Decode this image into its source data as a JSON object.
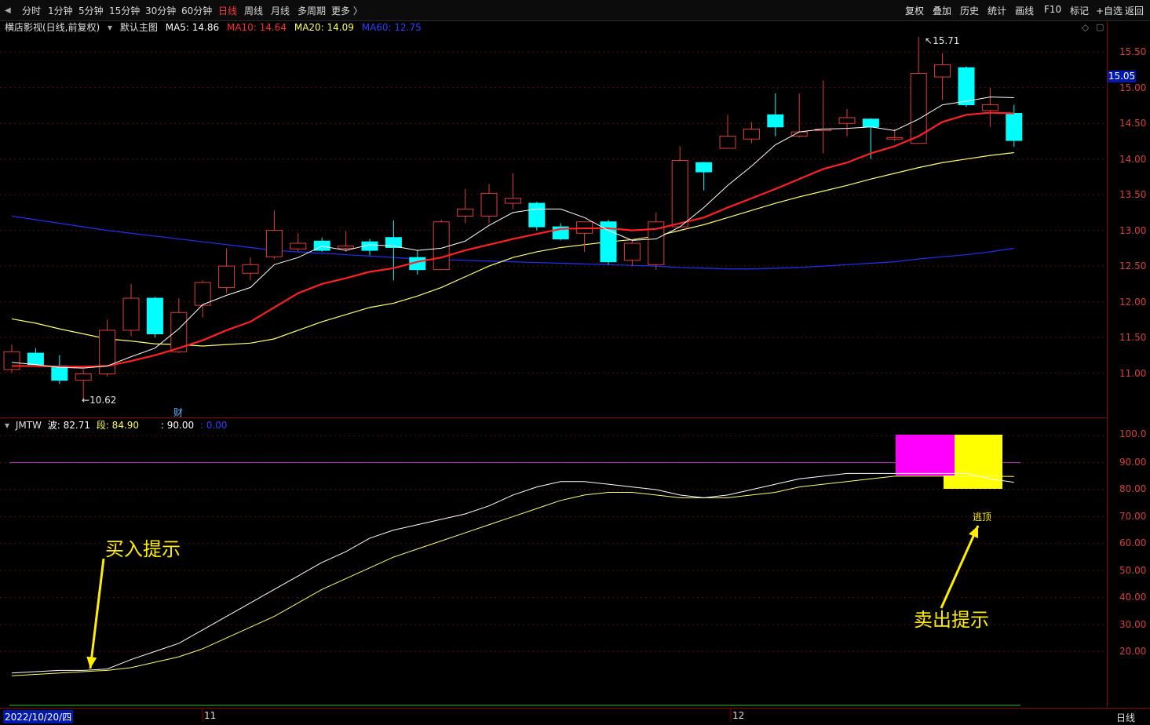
{
  "toolbar": {
    "timeframes": [
      "分时",
      "1分钟",
      "5分钟",
      "15分钟",
      "30分钟",
      "60分钟",
      "日线",
      "周线",
      "月线",
      "多周期",
      "更多 〉"
    ],
    "active_timeframe": "日线",
    "actions": [
      "复权",
      "叠加",
      "历史",
      "统计",
      "画线",
      "F10",
      "标记",
      "+自选",
      "返回"
    ]
  },
  "main_legend": {
    "stock": "横店影视(日线,前复权)",
    "template": "默认主图",
    "ma5": "MA5: 14.86",
    "ma10": "MA10: 14.64",
    "ma20": "MA20: 14.09",
    "ma60": "MA60: 12.75"
  },
  "sub_legend": {
    "name": "JMTW",
    "bo": "波: 82.71",
    "duan": "段: 84.90",
    "v3": ": 90.00",
    "v4": ": 0.00"
  },
  "price_axis": [
    "15.50",
    "15.00",
    "14.50",
    "14.00",
    "13.50",
    "13.00",
    "12.50",
    "12.00",
    "11.50",
    "11.00"
  ],
  "current_price": "15.05",
  "indicator_axis": [
    "100.0",
    "90.00",
    "80.00",
    "70.00",
    "60.00",
    "50.00",
    "40.00",
    "30.00",
    "20.00"
  ],
  "labels": {
    "high": "15.71",
    "low": "10.62",
    "finance_mark": "财",
    "escape_top": "逃顶",
    "buy_hint": "买入提示",
    "sell_hint": "卖出提示"
  },
  "date_axis": {
    "start": "2022/10/20/四",
    "month_nov": "11",
    "month_dec": "12",
    "period": "日线"
  },
  "colors": {
    "up": "#e03c3c",
    "down": "#00ffff",
    "ma5": "#ffffff",
    "ma10": "#ff2020",
    "ma20": "#ffff66",
    "ma60": "#2030ff",
    "annotation": "#ffee00"
  },
  "chart_data": {
    "type": "candlestick",
    "price_range": [
      10.5,
      15.8
    ],
    "candles": [
      {
        "o": 11.05,
        "h": 11.4,
        "l": 11.0,
        "c": 11.3
      },
      {
        "o": 11.28,
        "h": 11.35,
        "l": 11.1,
        "c": 11.12
      },
      {
        "o": 11.1,
        "h": 11.25,
        "l": 10.85,
        "c": 10.9
      },
      {
        "o": 10.9,
        "h": 11.05,
        "l": 10.62,
        "c": 10.99
      },
      {
        "o": 10.99,
        "h": 11.75,
        "l": 10.95,
        "c": 11.6
      },
      {
        "o": 11.6,
        "h": 12.25,
        "l": 11.52,
        "c": 12.05
      },
      {
        "o": 12.05,
        "h": 12.07,
        "l": 11.5,
        "c": 11.55
      },
      {
        "o": 11.3,
        "h": 12.05,
        "l": 11.28,
        "c": 11.85
      },
      {
        "o": 11.95,
        "h": 12.3,
        "l": 11.78,
        "c": 12.27
      },
      {
        "o": 12.2,
        "h": 12.75,
        "l": 12.12,
        "c": 12.5
      },
      {
        "o": 12.4,
        "h": 12.62,
        "l": 12.3,
        "c": 12.52
      },
      {
        "o": 12.63,
        "h": 13.28,
        "l": 12.6,
        "c": 13.0
      },
      {
        "o": 12.74,
        "h": 12.96,
        "l": 12.7,
        "c": 12.82
      },
      {
        "o": 12.85,
        "h": 12.9,
        "l": 12.7,
        "c": 12.72
      },
      {
        "o": 12.75,
        "h": 12.99,
        "l": 12.7,
        "c": 12.78
      },
      {
        "o": 12.84,
        "h": 12.88,
        "l": 12.65,
        "c": 12.72
      },
      {
        "o": 12.9,
        "h": 13.14,
        "l": 12.3,
        "c": 12.76
      },
      {
        "o": 12.62,
        "h": 12.72,
        "l": 12.38,
        "c": 12.45
      },
      {
        "o": 12.45,
        "h": 13.15,
        "l": 12.45,
        "c": 13.12
      },
      {
        "o": 13.2,
        "h": 13.58,
        "l": 13.1,
        "c": 13.3
      },
      {
        "o": 13.2,
        "h": 13.65,
        "l": 13.1,
        "c": 13.52
      },
      {
        "o": 13.38,
        "h": 13.8,
        "l": 13.3,
        "c": 13.45
      },
      {
        "o": 13.38,
        "h": 13.4,
        "l": 13.0,
        "c": 13.05
      },
      {
        "o": 13.05,
        "h": 13.1,
        "l": 12.86,
        "c": 12.88
      },
      {
        "o": 12.96,
        "h": 13.12,
        "l": 12.7,
        "c": 13.12
      },
      {
        "o": 13.12,
        "h": 13.15,
        "l": 12.52,
        "c": 12.56
      },
      {
        "o": 12.58,
        "h": 12.88,
        "l": 12.5,
        "c": 12.82
      },
      {
        "o": 12.52,
        "h": 13.25,
        "l": 12.45,
        "c": 13.12
      },
      {
        "o": 13.05,
        "h": 14.18,
        "l": 13.05,
        "c": 13.98
      },
      {
        "o": 13.95,
        "h": 13.96,
        "l": 13.56,
        "c": 13.82
      },
      {
        "o": 14.15,
        "h": 14.62,
        "l": 14.15,
        "c": 14.32
      },
      {
        "o": 14.28,
        "h": 14.52,
        "l": 14.22,
        "c": 14.42
      },
      {
        "o": 14.62,
        "h": 14.92,
        "l": 14.32,
        "c": 14.45
      },
      {
        "o": 14.32,
        "h": 14.92,
        "l": 14.3,
        "c": 14.38
      },
      {
        "o": 14.4,
        "h": 15.1,
        "l": 14.08,
        "c": 14.42
      },
      {
        "o": 14.5,
        "h": 14.7,
        "l": 14.32,
        "c": 14.58
      },
      {
        "o": 14.56,
        "h": 14.57,
        "l": 14.0,
        "c": 14.45
      },
      {
        "o": 14.28,
        "h": 14.42,
        "l": 14.25,
        "c": 14.3
      },
      {
        "o": 14.22,
        "h": 15.71,
        "l": 14.22,
        "c": 15.2
      },
      {
        "o": 15.15,
        "h": 15.48,
        "l": 14.83,
        "c": 15.32
      },
      {
        "o": 15.28,
        "h": 15.3,
        "l": 14.73,
        "c": 14.76
      },
      {
        "o": 14.68,
        "h": 15.0,
        "l": 14.45,
        "c": 14.76
      },
      {
        "o": 14.64,
        "h": 14.76,
        "l": 14.17,
        "c": 14.26
      }
    ],
    "ma5": [
      11.15,
      11.12,
      11.08,
      11.07,
      11.1,
      11.23,
      11.35,
      11.62,
      11.96,
      12.09,
      12.2,
      12.52,
      12.62,
      12.78,
      12.72,
      12.8,
      12.78,
      12.72,
      12.75,
      12.85,
      13.07,
      13.25,
      13.3,
      13.3,
      13.18,
      13.0,
      12.86,
      12.88,
      13.05,
      13.32,
      13.63,
      13.9,
      14.2,
      14.38,
      14.42,
      14.43,
      14.45,
      14.4,
      14.56,
      14.76,
      14.81,
      14.87,
      14.86
    ],
    "ma10": [
      11.1,
      11.1,
      11.09,
      11.09,
      11.1,
      11.17,
      11.25,
      11.35,
      11.46,
      11.6,
      11.72,
      11.92,
      12.12,
      12.25,
      12.33,
      12.42,
      12.47,
      12.56,
      12.62,
      12.72,
      12.8,
      12.88,
      12.95,
      13.02,
      13.03,
      13.03,
      13.0,
      13.02,
      13.1,
      13.18,
      13.32,
      13.45,
      13.58,
      13.72,
      13.86,
      13.95,
      14.08,
      14.18,
      14.32,
      14.52,
      14.62,
      14.65,
      14.64
    ],
    "ma20": [
      11.76,
      11.7,
      11.62,
      11.55,
      11.48,
      11.45,
      11.41,
      11.4,
      11.38,
      11.4,
      11.42,
      11.48,
      11.6,
      11.72,
      11.82,
      11.92,
      11.98,
      12.08,
      12.2,
      12.35,
      12.5,
      12.62,
      12.7,
      12.76,
      12.8,
      12.84,
      12.87,
      12.92,
      13.0,
      13.08,
      13.18,
      13.28,
      13.38,
      13.47,
      13.55,
      13.63,
      13.72,
      13.8,
      13.88,
      13.95,
      14.0,
      14.05,
      14.09
    ],
    "ma60": [
      13.2,
      13.15,
      13.1,
      13.05,
      13.0,
      12.96,
      12.92,
      12.88,
      12.84,
      12.8,
      12.76,
      12.72,
      12.7,
      12.68,
      12.66,
      12.64,
      12.62,
      12.6,
      12.59,
      12.58,
      12.57,
      12.56,
      12.55,
      12.54,
      12.53,
      12.52,
      12.51,
      12.5,
      12.48,
      12.47,
      12.46,
      12.46,
      12.47,
      12.48,
      12.5,
      12.52,
      12.54,
      12.56,
      12.6,
      12.63,
      12.66,
      12.7,
      12.75
    ],
    "indicator": {
      "range": [
        0,
        103
      ],
      "bo": [
        12,
        12.5,
        13,
        13,
        13.5,
        17,
        20,
        23,
        28,
        33,
        38,
        43,
        48,
        53,
        57,
        62,
        65,
        67,
        69,
        71,
        74,
        78,
        81,
        83,
        83,
        82,
        81,
        80,
        78,
        77,
        78,
        80,
        82,
        84,
        85,
        86,
        86,
        86,
        86,
        86,
        86,
        84,
        82.71
      ],
      "duan": [
        11,
        11.5,
        12,
        12.5,
        13,
        14,
        16,
        18,
        21,
        25,
        29,
        33,
        38,
        43,
        47,
        51,
        55,
        58,
        61,
        64,
        67,
        70,
        73,
        76,
        78,
        79,
        79,
        78,
        77,
        77,
        77,
        78,
        79,
        81,
        82,
        83,
        84,
        85,
        85,
        85,
        85,
        85,
        84.9
      ],
      "level": 90
    }
  }
}
